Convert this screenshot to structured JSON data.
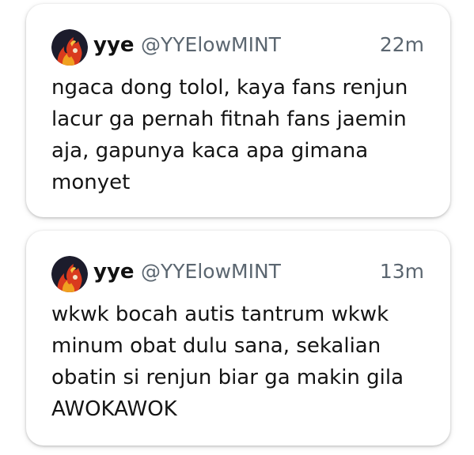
{
  "tweets": [
    {
      "name": "yye",
      "handle": "@YYElowMINT",
      "time": "22m",
      "lines": [
        "ngaca dong tolol, kaya fans renjun",
        "lacur ga pernah fitnah fans jaemin",
        "aja, gapunya kaca apa gimana",
        "monyet"
      ],
      "avatar_icon": "flame-avatar-icon"
    },
    {
      "name": "yye",
      "handle": "@YYElowMINT",
      "time": "13m",
      "lines": [
        "wkwk bocah autis tantrum wkwk",
        "minum obat dulu sana, sekalian",
        "obatin si renjun biar ga makin gila",
        "AWOKAWOK"
      ],
      "avatar_icon": "flame-avatar-icon"
    }
  ],
  "colors": {
    "background": "#ffffff",
    "card": "#ffffff",
    "name": "#111111",
    "meta": "#5b6670",
    "text": "#141414",
    "avatar_bg": "#1c1c2c",
    "avatar_flame": "#d93a1e",
    "avatar_flame_light": "#f0a020"
  }
}
